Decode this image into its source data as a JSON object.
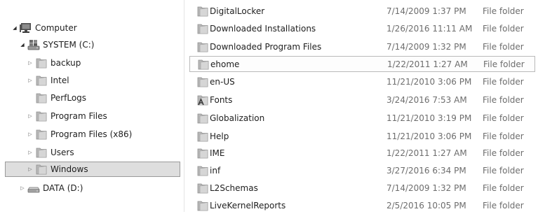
{
  "nav": {
    "items": [
      {
        "label": "Computer",
        "icon": "computer-icon",
        "expander": "expanded"
      },
      {
        "label": "SYSTEM (C:)",
        "icon": "system-drive-icon",
        "expander": "expanded"
      },
      {
        "label": "backup",
        "icon": "folder-icon",
        "expander": "collapsed"
      },
      {
        "label": "Intel",
        "icon": "folder-icon",
        "expander": "collapsed"
      },
      {
        "label": "PerfLogs",
        "icon": "folder-icon",
        "expander": "none"
      },
      {
        "label": "Program Files",
        "icon": "folder-icon",
        "expander": "collapsed"
      },
      {
        "label": "Program Files (x86)",
        "icon": "folder-icon",
        "expander": "collapsed"
      },
      {
        "label": "Users",
        "icon": "folder-icon",
        "expander": "collapsed"
      },
      {
        "label": "Windows",
        "icon": "folder-icon",
        "expander": "collapsed",
        "selected": true
      },
      {
        "label": "DATA (D:)",
        "icon": "drive-icon",
        "expander": "collapsed"
      }
    ]
  },
  "files": [
    {
      "name": "DigitalLocker",
      "date": "7/14/2009 1:37 PM",
      "type": "File folder",
      "icon": "folder-icon"
    },
    {
      "name": "Downloaded Installations",
      "date": "1/26/2016 11:11 AM",
      "type": "File folder",
      "icon": "folder-icon"
    },
    {
      "name": "Downloaded Program Files",
      "date": "7/14/2009 1:32 PM",
      "type": "File folder",
      "icon": "folder-icon"
    },
    {
      "name": "ehome",
      "date": "1/22/2011 1:27 AM",
      "type": "File folder",
      "icon": "folder-icon",
      "highlighted": true
    },
    {
      "name": "en-US",
      "date": "11/21/2010 3:06 PM",
      "type": "File folder",
      "icon": "folder-icon"
    },
    {
      "name": "Fonts",
      "date": "3/24/2016 7:53 AM",
      "type": "File folder",
      "icon": "fonts-folder-icon"
    },
    {
      "name": "Globalization",
      "date": "11/21/2010 3:19 PM",
      "type": "File folder",
      "icon": "folder-icon"
    },
    {
      "name": "Help",
      "date": "11/21/2010 3:06 PM",
      "type": "File folder",
      "icon": "folder-icon"
    },
    {
      "name": "IME",
      "date": "1/22/2011 1:27 AM",
      "type": "File folder",
      "icon": "folder-icon"
    },
    {
      "name": "inf",
      "date": "3/27/2016 6:34 PM",
      "type": "File folder",
      "icon": "folder-icon"
    },
    {
      "name": "L2Schemas",
      "date": "7/14/2009 1:32 PM",
      "type": "File folder",
      "icon": "folder-icon"
    },
    {
      "name": "LiveKernelReports",
      "date": "2/5/2016 10:05 PM",
      "type": "File folder",
      "icon": "folder-icon"
    }
  ],
  "colors": {
    "folder": "#c8c8c8",
    "selection_bg": "#dedede",
    "selection_border": "#9a9a9a"
  }
}
